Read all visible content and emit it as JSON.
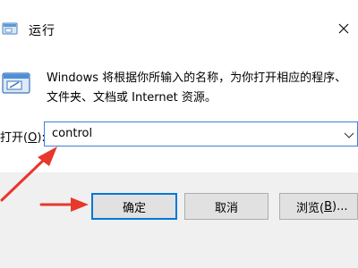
{
  "window": {
    "title": "运行"
  },
  "description": {
    "line1": "Windows 将根据你所输入的名称，为你打开相应的程序、",
    "line2": "文件夹、文档或 Internet 资源。"
  },
  "open_field": {
    "label_prefix": "打开(",
    "label_key": "O",
    "label_suffix": "):",
    "value": "control"
  },
  "buttons": {
    "ok": "确定",
    "cancel": "取消",
    "browse_prefix": "浏览(",
    "browse_key": "B",
    "browse_suffix": ")..."
  },
  "colors": {
    "annotation_arrow": "#e8372c",
    "focus_border": "#0078d7",
    "footer_bg": "#f0f0f0"
  }
}
